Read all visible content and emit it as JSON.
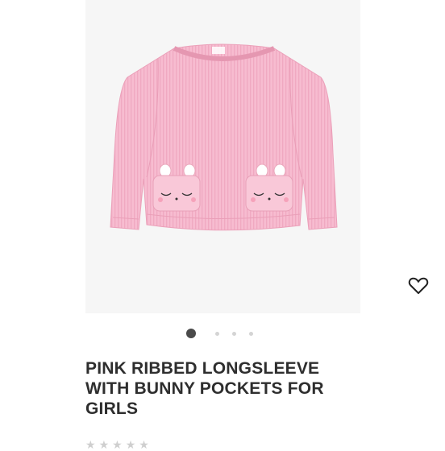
{
  "product": {
    "title": "PINK RIBBED LONGSLEEVE WITH BUNNY POCKETS FOR GIRLS"
  },
  "gallery": {
    "image_count": 4,
    "active_index": 0
  },
  "icons": {
    "wishlist": "heart-outline-icon",
    "rating": "star-icon"
  },
  "colors": {
    "garment": "#f7bcd0",
    "active_dot": "#4a4a4a",
    "inactive_dot": "#d4d4d4",
    "title_text": "#2e2e2e"
  }
}
